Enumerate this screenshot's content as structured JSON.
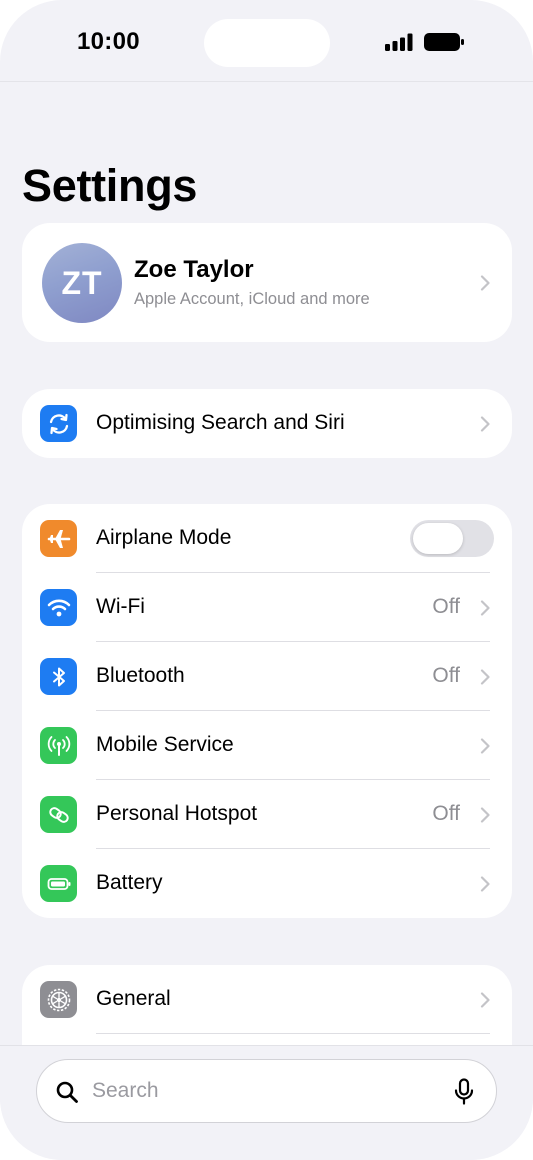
{
  "status_bar": {
    "time": "10:00"
  },
  "page_title": "Settings",
  "profile": {
    "initials": "ZT",
    "name": "Zoe Taylor",
    "subtitle": "Apple Account, iCloud and more"
  },
  "siri_banner": {
    "label": "Optimising Search and Siri",
    "icon": "sync-arrows-icon",
    "color": "#1e7cf2"
  },
  "connectivity": [
    {
      "label": "Airplane Mode",
      "value": "",
      "icon": "airplane-icon",
      "color": "#f08a2c",
      "toggle": "off"
    },
    {
      "label": "Wi-Fi",
      "value": "Off",
      "icon": "wifi-icon",
      "color": "#1e7cf2"
    },
    {
      "label": "Bluetooth",
      "value": "Off",
      "icon": "bluetooth-icon",
      "color": "#1e7cf2"
    },
    {
      "label": "Mobile Service",
      "value": "",
      "icon": "antenna-icon",
      "color": "#34c759"
    },
    {
      "label": "Personal Hotspot",
      "value": "Off",
      "icon": "link-icon",
      "color": "#34c759"
    },
    {
      "label": "Battery",
      "value": "",
      "icon": "battery-icon",
      "color": "#34c759"
    }
  ],
  "general_group": [
    {
      "label": "General",
      "value": "",
      "icon": "gear-icon",
      "color": "#8e8e93"
    }
  ],
  "search": {
    "placeholder": "Search",
    "icon": "search-icon",
    "mic_icon": "microphone-icon"
  }
}
